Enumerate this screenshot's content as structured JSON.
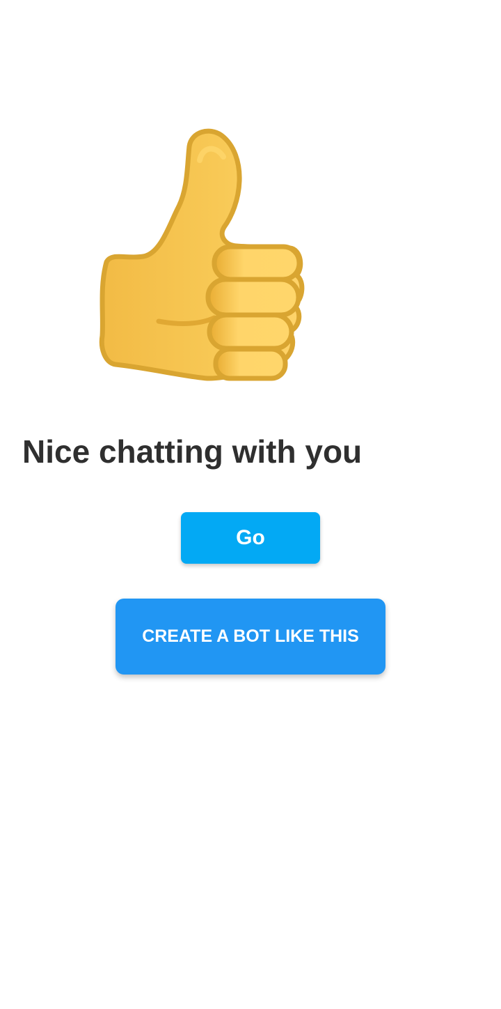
{
  "screen": {
    "background_color": "#ffffff"
  },
  "illustration": {
    "icon": "thumbs-up-icon",
    "colors": {
      "fill": "#f7c64f",
      "outline": "#d9a531",
      "highlight": "#ffd66b"
    }
  },
  "message": {
    "title": "Nice chatting with you"
  },
  "actions": {
    "go": {
      "label": "Go",
      "color": "#03a9f4"
    },
    "create_bot": {
      "label": "CREATE A BOT LIKE THIS",
      "color": "#2196f3"
    }
  }
}
